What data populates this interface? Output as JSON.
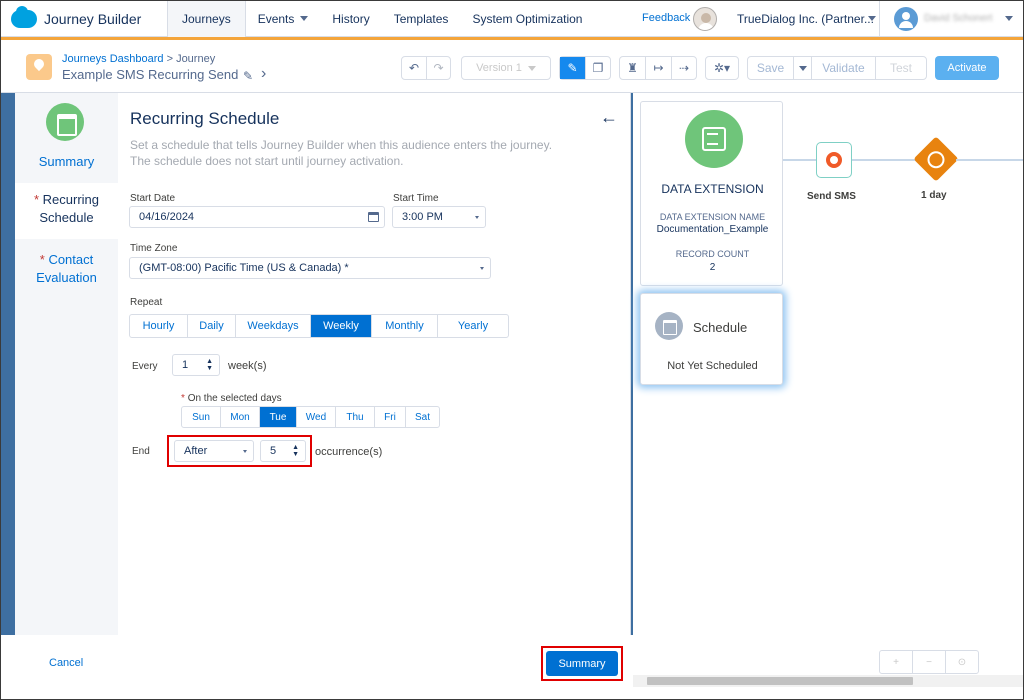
{
  "app": {
    "title": "Journey Builder"
  },
  "nav": {
    "tabs": [
      "Journeys",
      "Events",
      "History",
      "Templates",
      "System Optimization"
    ],
    "feedback": "Feedback",
    "org": "TrueDialog Inc. (Partner...",
    "user": "David Schonert"
  },
  "header": {
    "breadcrumb_root": "Journeys Dashboard",
    "breadcrumb_sep": " > ",
    "breadcrumb_current": "Journey",
    "journey_name": "Example SMS Recurring Send",
    "version": "Version 1",
    "save": "Save",
    "validate": "Validate",
    "test": "Test",
    "activate": "Activate"
  },
  "leftnav": {
    "summary": "Summary",
    "recurring": "Recurring Schedule",
    "contact": "Contact Evaluation",
    "required_mark": "*"
  },
  "panel": {
    "title": "Recurring Schedule",
    "description": "Set a schedule that tells Journey Builder when this audience enters the journey. The schedule does not start until journey activation.",
    "start_date_label": "Start Date",
    "start_date_value": "04/16/2024",
    "start_time_label": "Start Time",
    "start_time_value": "3:00 PM",
    "timezone_label": "Time Zone",
    "timezone_value": "(GMT-08:00) Pacific Time (US & Canada) *",
    "repeat_label": "Repeat",
    "repeat_options": [
      "Hourly",
      "Daily",
      "Weekdays",
      "Weekly",
      "Monthly",
      "Yearly"
    ],
    "repeat_selected": "Weekly",
    "every_label": "Every",
    "every_value": "1",
    "every_unit": "week(s)",
    "days_label": "On the selected days",
    "days": [
      "Sun",
      "Mon",
      "Tue",
      "Wed",
      "Thu",
      "Fri",
      "Sat"
    ],
    "days_selected": "Tue",
    "end_label": "End",
    "end_mode": "After",
    "end_count": "5",
    "end_unit": "occurrence(s)"
  },
  "footer": {
    "cancel": "Cancel",
    "summary": "Summary"
  },
  "canvas": {
    "de_title": "DATA EXTENSION",
    "de_name_label": "DATA EXTENSION NAME",
    "de_name_value": "Documentation_Example",
    "record_count_label": "RECORD COUNT",
    "record_count_value": "2",
    "schedule_title": "Schedule",
    "schedule_status": "Not Yet Scheduled",
    "send_sms": "Send SMS",
    "wait": "1 day"
  },
  "colors": {
    "accent": "#0070d2",
    "header_stripe": "#f4a53b",
    "highlight": "#e00000"
  }
}
